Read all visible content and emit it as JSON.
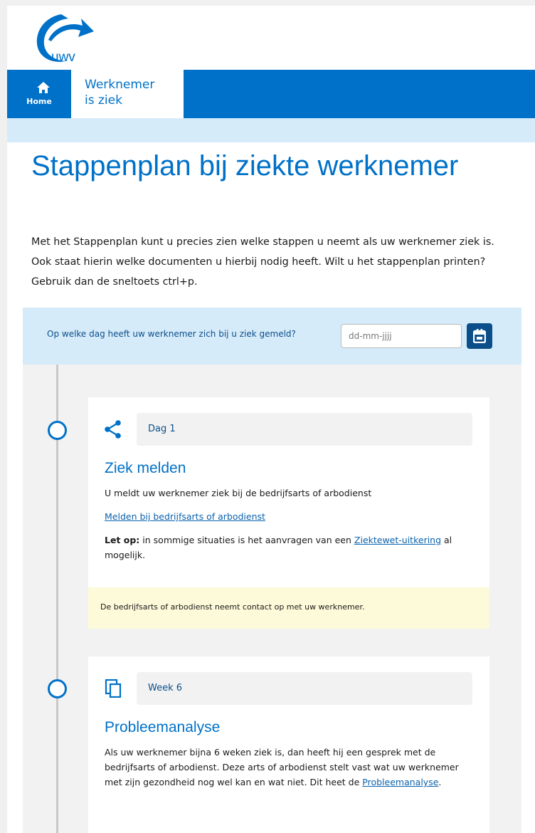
{
  "brand": {
    "logo_text": "uwv",
    "primary_color": "#0071c8",
    "dark_color": "#0b4f8a",
    "light_color": "#d6ebfa"
  },
  "nav": {
    "home_label": "Home",
    "tab_line1": "Werknemer",
    "tab_line2": "is ziek"
  },
  "page": {
    "title": "Stappenplan bij ziekte werknemer",
    "intro": "Met het Stappenplan kunt u precies zien welke stappen u neemt als uw werknemer ziek is. Ook staat hierin welke documenten u hierbij nodig heeft. Wilt u het stappenplan printen? Gebruik dan de sneltoets ctrl+p."
  },
  "question": {
    "label": "Op welke dag heeft uw werknemer zich bij u ziek gemeld?",
    "placeholder": "dd-mm-jjjj",
    "value": ""
  },
  "steps": [
    {
      "icon": "share-icon",
      "when": "Dag 1",
      "title": "Ziek melden",
      "text": "U meldt uw werknemer ziek bij de bedrijfsarts of arbodienst",
      "link": "Melden bij bedrijfsarts of arbodienst",
      "warning_bold": "Let op:",
      "warning_text_before": " in sommige situaties is het aanvragen van een ",
      "warning_link": "Ziektewet-uitkering",
      "warning_text_after": " al mogelijk.",
      "note": "De bedrijfsarts of arbodienst neemt contact op met uw werknemer."
    },
    {
      "icon": "copy-icon",
      "when": "Week 6",
      "title": "Probleemanalyse",
      "text_before": "Als uw werknemer bijna 6 weken ziek is, dan heeft hij een gesprek met de bedrijfsarts of arbodienst. Deze arts of arbodienst stelt vast wat uw werknemer met zijn gezondheid nog wel kan en wat niet. Dit heet de ",
      "text_link": "Probleemanalyse",
      "text_after": "."
    }
  ]
}
